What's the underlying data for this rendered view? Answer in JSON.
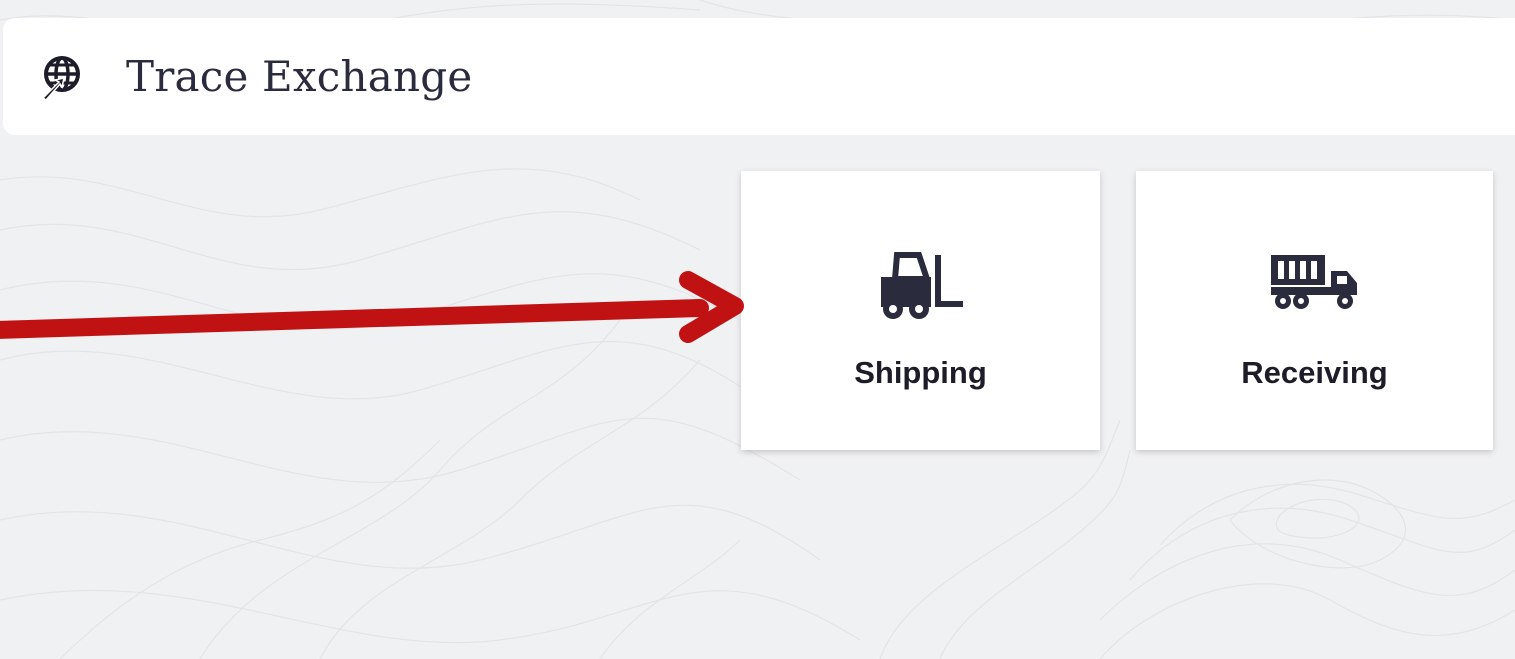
{
  "app": {
    "title": "Trace Exchange",
    "logo_icon": "globe-arrow-icon"
  },
  "tiles": [
    {
      "label": "Shipping",
      "icon": "forklift-icon"
    },
    {
      "label": "Receiving",
      "icon": "container-truck-icon"
    }
  ],
  "annotation": {
    "type": "arrow",
    "color": "#c01212",
    "points_to": "Shipping"
  },
  "colors": {
    "background": "#f0f1f3",
    "surface": "#ffffff",
    "text": "#2a2b3d",
    "icon": "#2a2b3d"
  }
}
